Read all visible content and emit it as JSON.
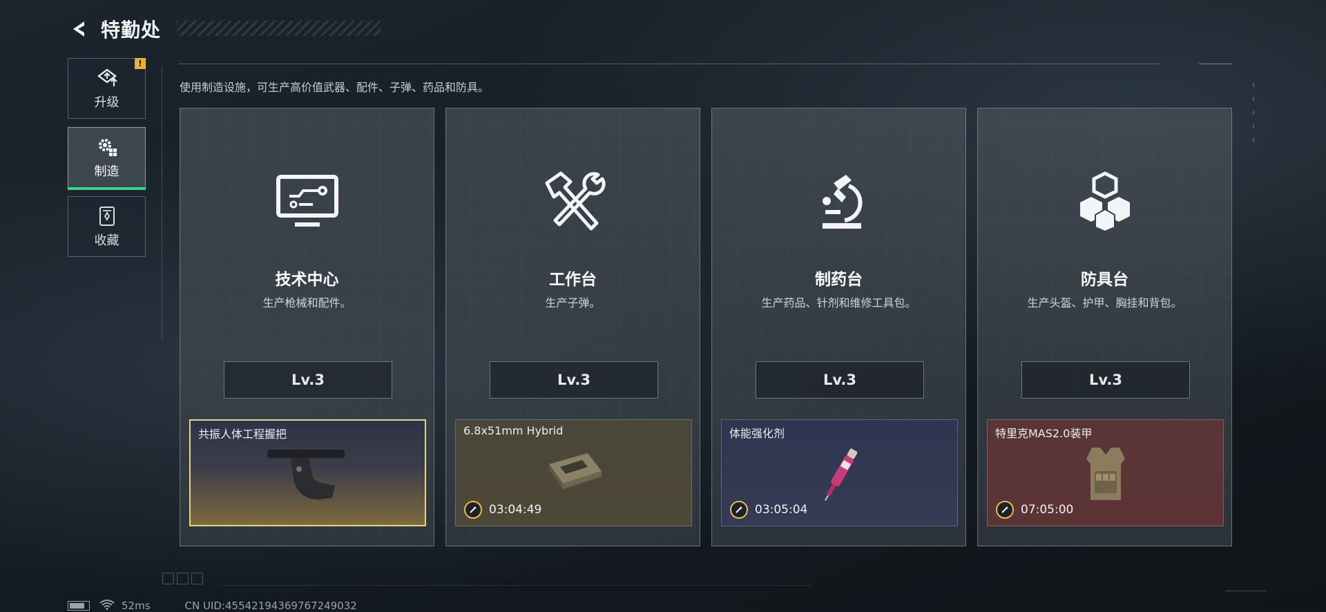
{
  "header": {
    "title": "特勤处"
  },
  "sidebar": {
    "items": [
      {
        "label": "升级",
        "icon": "upgrade-icon",
        "alert": "!"
      },
      {
        "label": "制造",
        "icon": "craft-icon",
        "active": true
      },
      {
        "label": "收藏",
        "icon": "collection-icon"
      }
    ]
  },
  "description": "使用制造设施，可生产高价值武器、配件、子弹、药品和防具。",
  "stations": [
    {
      "name": "技术中心",
      "desc": "生产枪械和配件。",
      "level": "Lv.3",
      "icon": "monitor-icon",
      "production": {
        "item": "共振人体工程握把",
        "timer": "",
        "bg": "gold"
      }
    },
    {
      "name": "工作台",
      "desc": "生产子弹。",
      "level": "Lv.3",
      "icon": "hammer-wrench-icon",
      "production": {
        "item": "6.8x51mm Hybrid",
        "timer": "03:04:49",
        "bg": "tan"
      }
    },
    {
      "name": "制药台",
      "desc": "生产药品、针剂和维修工具包。",
      "level": "Lv.3",
      "icon": "microscope-icon",
      "production": {
        "item": "体能强化剂",
        "timer": "03:05:04",
        "bg": "navy"
      }
    },
    {
      "name": "防具台",
      "desc": "生产头盔、护甲、胸挂和背包。",
      "level": "Lv.3",
      "icon": "cubes-icon",
      "production": {
        "item": "特里克MAS2.0装甲",
        "timer": "07:05:00",
        "bg": "red"
      }
    }
  ],
  "status": {
    "ping": "52ms",
    "uid": "CN UID:45542194369767249032"
  },
  "colors": {
    "accent": "#3ad18a",
    "gold": "#e6d58a",
    "alert": "#e8b23a"
  }
}
